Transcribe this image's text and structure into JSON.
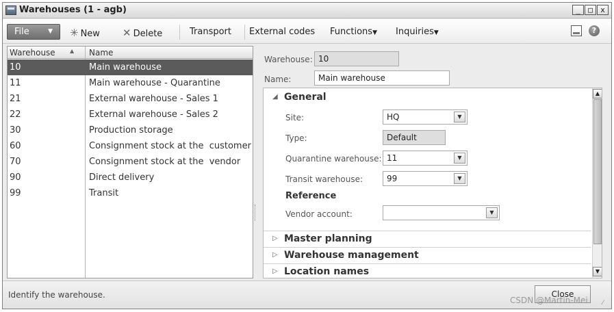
{
  "window": {
    "title": "Warehouses (1 - agb)"
  },
  "window_controls": {
    "minimize": "_",
    "maximize": "□",
    "close": "x"
  },
  "toolbar": {
    "file": "File",
    "new": "New",
    "delete": "Delete",
    "transport": "Transport",
    "external_codes": "External codes",
    "functions": "Functions",
    "inquiries": "Inquiries"
  },
  "grid": {
    "columns": [
      "Warehouse",
      "Name"
    ],
    "rows": [
      {
        "warehouse": "10",
        "name": "Main warehouse"
      },
      {
        "warehouse": "11",
        "name": "Main warehouse - Quarantine"
      },
      {
        "warehouse": "21",
        "name": "External warehouse - Sales 1"
      },
      {
        "warehouse": "22",
        "name": "External warehouse - Sales 2"
      },
      {
        "warehouse": "30",
        "name": "Production storage"
      },
      {
        "warehouse": "60",
        "name": "Consignment stock at the  customer"
      },
      {
        "warehouse": "70",
        "name": "Consignment stock at the  vendor"
      },
      {
        "warehouse": "90",
        "name": "Direct delivery"
      },
      {
        "warehouse": "99",
        "name": "Transit"
      }
    ],
    "selected_index": 0
  },
  "header": {
    "warehouse_label": "Warehouse:",
    "warehouse_value": "10",
    "name_label": "Name:",
    "name_value": "Main warehouse"
  },
  "general": {
    "title": "General",
    "site_label": "Site:",
    "site_value": "HQ",
    "type_label": "Type:",
    "type_value": "Default",
    "quarantine_label": "Quarantine warehouse:",
    "quarantine_value": "11",
    "transit_label": "Transit warehouse:",
    "transit_value": "99",
    "reference_title": "Reference",
    "vendor_label": "Vendor account:",
    "vendor_value": ""
  },
  "fasttabs": {
    "master_planning": "Master planning",
    "warehouse_management": "Warehouse management",
    "location_names": "Location names"
  },
  "status": {
    "text": "Identify the warehouse.",
    "close": "Close"
  },
  "watermark": "CSDN @Martin-Mei"
}
